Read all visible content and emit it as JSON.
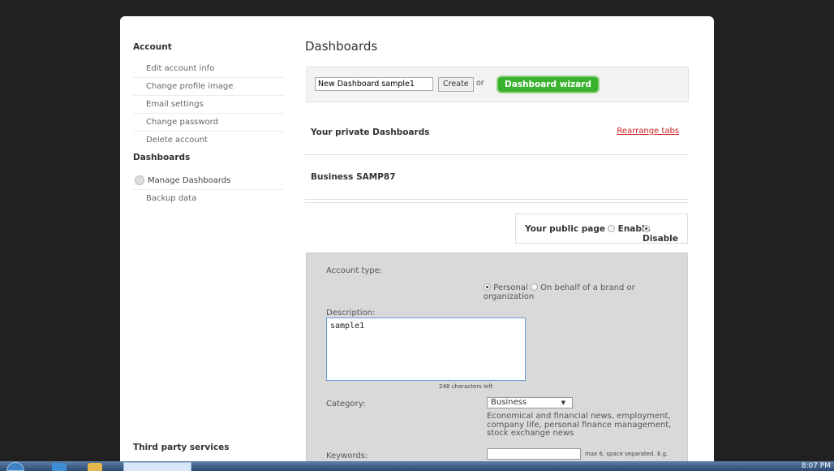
{
  "sidebar": {
    "account_heading": "Account",
    "account_items": [
      "Edit account info",
      "Change profile image",
      "Email settings",
      "Change password",
      "Delete account"
    ],
    "dashboards_heading": "Dashboards",
    "dashboard_items": [
      "Manage Dashboards",
      "Backup data"
    ],
    "third_party_heading": "Third party services"
  },
  "main": {
    "title": "Dashboards",
    "create": {
      "input_value": "New Dashboard sample1",
      "create_label": "Create",
      "or_label": "or",
      "wizard_label": "Dashboard wizard"
    },
    "private_title": "Your private Dashboards",
    "rearrange_label": "Rearrange tabs",
    "business_title": "Business SAMP87",
    "public_page": {
      "label": "Your public page",
      "enable_label": "Enable",
      "disable_label": "Disable",
      "selected": "Disable"
    },
    "form": {
      "account_type_label": "Account type:",
      "personal_label": "Personal",
      "brand_label": "On behalf of a brand or organization",
      "selected_type": "Personal",
      "description_label": "Description:",
      "description_value": "sample1",
      "chars_left": "248 characters left",
      "category_label": "Category:",
      "category_value": "Business",
      "category_desc": "Economical and financial news, employment, company life, personal finance management, stock exchange news",
      "keywords_label": "Keywords:",
      "keywords_value": "",
      "keywords_hint": "max 6, space separated. E.g."
    }
  },
  "taskbar": {
    "clock": "8:07 PM"
  },
  "colors": {
    "background": "#212121",
    "wizard_green": "#3bb22f",
    "rearrange_red": "#cc2222",
    "form_panel": "#d9d9d9"
  },
  "icons": [
    "start-orb-icon",
    "internet-explorer-icon",
    "folder-icon",
    "radio-icon"
  ]
}
